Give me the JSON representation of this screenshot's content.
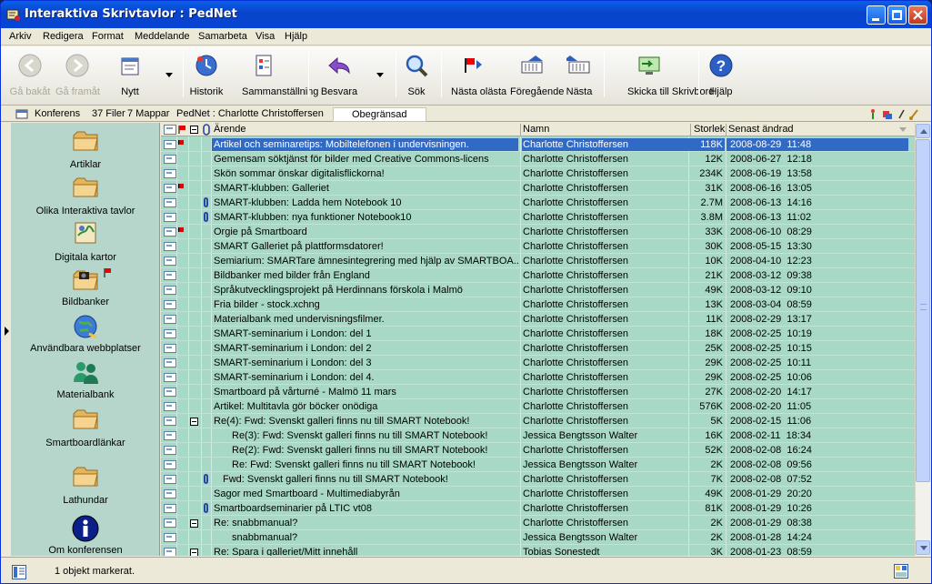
{
  "window": {
    "title": "Interaktiva Skrivtavlor : PedNet"
  },
  "menu": [
    "Arkiv",
    "Redigera",
    "Format",
    "Meddelande",
    "Samarbeta",
    "Visa",
    "Hjälp"
  ],
  "toolbar": {
    "back": "Gå bakåt",
    "forward": "Gå framåt",
    "new": "Nytt",
    "history": "Historik",
    "summary": "Sammanställning",
    "reply": "Besvara",
    "search": "Sök",
    "next_unread": "Nästa olästa",
    "previous": "Föregående",
    "next": "Nästa",
    "send_desktop": "Skicka till Skrivbord",
    "help": "Hjälp"
  },
  "info": {
    "type": "Konferens",
    "files": "37 Filer",
    "folders": "7 Mappar",
    "path": "PedNet : Charlotte Christoffersen",
    "limit": "Obegränsad"
  },
  "sidebar": [
    {
      "label": "Artiklar",
      "icon": "folder-icon"
    },
    {
      "label": "Olika Interaktiva tavlor",
      "icon": "folder-icon"
    },
    {
      "label": "Digitala kartor",
      "icon": "map-icon"
    },
    {
      "label": "Bildbanker",
      "icon": "folder-camera-icon"
    },
    {
      "label": "Användbara webbplatser",
      "icon": "globe-icon"
    },
    {
      "label": "Materialbank",
      "icon": "users-icon"
    },
    {
      "label": "Smartboardlänkar",
      "icon": "folder-icon"
    },
    {
      "label": "Lathundar",
      "icon": "folder-icon"
    },
    {
      "label": "Om konferensen",
      "icon": "info-icon"
    }
  ],
  "columns": {
    "subject": "Ärende",
    "name": "Namn",
    "size": "Storlek",
    "date": "Senast ändrad"
  },
  "rows": [
    {
      "subject": "Artikel och seminaretips: Mobiltelefonen i undervisningen.",
      "name": "Charlotte Christoffersen",
      "size": "118K",
      "date": "2008-08-29  11:48",
      "flag": true,
      "clip": false,
      "selected": true
    },
    {
      "subject": "Gemensam söktjänst för bilder med Creative Commons-licens",
      "name": "Charlotte Christoffersen",
      "size": "12K",
      "date": "2008-06-27  12:18"
    },
    {
      "subject": "Skön sommar önskar digitalisflickorna!",
      "name": "Charlotte Christoffersen",
      "size": "234K",
      "date": "2008-06-19  13:58"
    },
    {
      "subject": "SMART-klubben: Galleriet",
      "name": "Charlotte Christoffersen",
      "size": "31K",
      "date": "2008-06-16  13:05",
      "flag": true
    },
    {
      "subject": "SMART-klubben: Ladda hem Notebook 10",
      "name": "Charlotte Christoffersen",
      "size": "2.7M",
      "date": "2008-06-13  14:16",
      "clip": true
    },
    {
      "subject": "SMART-klubben: nya funktioner Notebook10",
      "name": "Charlotte Christoffersen",
      "size": "3.8M",
      "date": "2008-06-13  11:02",
      "clip": true
    },
    {
      "subject": "Orgie på Smartboard",
      "name": "Charlotte Christoffersen",
      "size": "33K",
      "date": "2008-06-10  08:29",
      "flag": true
    },
    {
      "subject": "SMART Galleriet på plattformsdatorer!",
      "name": "Charlotte Christoffersen",
      "size": "30K",
      "date": "2008-05-15  13:30"
    },
    {
      "subject": "Semiarium: SMARTare ämnesintegrering med hjälp av SMARTBOA...",
      "name": "Charlotte Christoffersen",
      "size": "10K",
      "date": "2008-04-10  12:23"
    },
    {
      "subject": "Bildbanker med bilder från England",
      "name": "Charlotte Christoffersen",
      "size": "21K",
      "date": "2008-03-12  09:38"
    },
    {
      "subject": "Språkutvecklingsprojekt på Herdinnans förskola i Malmö",
      "name": "Charlotte Christoffersen",
      "size": "49K",
      "date": "2008-03-12  09:10"
    },
    {
      "subject": "Fria bilder - stock.xchng",
      "name": "Charlotte Christoffersen",
      "size": "13K",
      "date": "2008-03-04  08:59"
    },
    {
      "subject": "Materialbank med undervisningsfilmer.",
      "name": "Charlotte Christoffersen",
      "size": "11K",
      "date": "2008-02-29  13:17"
    },
    {
      "subject": "SMART-seminarium i London: del 1",
      "name": "Charlotte Christoffersen",
      "size": "18K",
      "date": "2008-02-25  10:19"
    },
    {
      "subject": "SMART-seminarium i London: del 2",
      "name": "Charlotte Christoffersen",
      "size": "25K",
      "date": "2008-02-25  10:15"
    },
    {
      "subject": "SMART-seminarium i London: del 3",
      "name": "Charlotte Christoffersen",
      "size": "29K",
      "date": "2008-02-25  10:11"
    },
    {
      "subject": "SMART-seminarium i London: del 4.",
      "name": "Charlotte Christoffersen",
      "size": "29K",
      "date": "2008-02-25  10:06"
    },
    {
      "subject": "Smartboard på vårturné - Malmö 11 mars",
      "name": "Charlotte Christoffersen",
      "size": "27K",
      "date": "2008-02-20  14:17"
    },
    {
      "subject": "Artikel: Multitavla gör böcker onödiga",
      "name": "Charlotte Christoffersen",
      "size": "576K",
      "date": "2008-02-20  11:05"
    },
    {
      "subject": "Re(4): Fwd: Svenskt galleri finns nu till SMART Notebook!",
      "name": "Charlotte Christoffersen",
      "size": "5K",
      "date": "2008-02-15  11:06",
      "minus": true
    },
    {
      "subject": "Re(3): Fwd: Svenskt galleri finns nu till SMART Notebook!",
      "name": "Jessica Bengtsson Walter",
      "size": "16K",
      "date": "2008-02-11  18:34",
      "indent": 2
    },
    {
      "subject": "Re(2): Fwd: Svenskt galleri finns nu till SMART Notebook!",
      "name": "Charlotte Christoffersen",
      "size": "52K",
      "date": "2008-02-08  16:24",
      "indent": 2
    },
    {
      "subject": "Re: Fwd: Svenskt galleri finns nu till SMART Notebook!",
      "name": "Jessica Bengtsson Walter",
      "size": "2K",
      "date": "2008-02-08  09:56",
      "indent": 2
    },
    {
      "subject": "Fwd: Svenskt galleri finns nu till SMART Notebook!",
      "name": "Charlotte Christoffersen",
      "size": "7K",
      "date": "2008-02-08  07:52",
      "indent": 1,
      "clip": true
    },
    {
      "subject": "Sagor med Smartboard - Multimediabyrån",
      "name": "Charlotte Christoffersen",
      "size": "49K",
      "date": "2008-01-29  20:20"
    },
    {
      "subject": "Smartboardseminarier på LTIC vt08",
      "name": "Charlotte Christoffersen",
      "size": "81K",
      "date": "2008-01-29  10:26",
      "clip": true
    },
    {
      "subject": "Re: snabbmanual?",
      "name": "Charlotte Christoffersen",
      "size": "2K",
      "date": "2008-01-29  08:38",
      "minus": true
    },
    {
      "subject": "snabbmanual?",
      "name": "Jessica Bengtsson Walter",
      "size": "2K",
      "date": "2008-01-28  14:24",
      "indent": 2
    },
    {
      "subject": "Re: Spara i galleriet/Mitt innehåll",
      "name": "Tobias Sonestedt",
      "size": "3K",
      "date": "2008-01-23  08:59",
      "minus": true
    }
  ],
  "status": {
    "text": "1 objekt markerat."
  },
  "colors": {
    "accent": "#316ac5",
    "grid_bg": "#a8d9c6",
    "sidebar_bg": "#b6d6cc",
    "title_bar": "#0a5fe8"
  }
}
